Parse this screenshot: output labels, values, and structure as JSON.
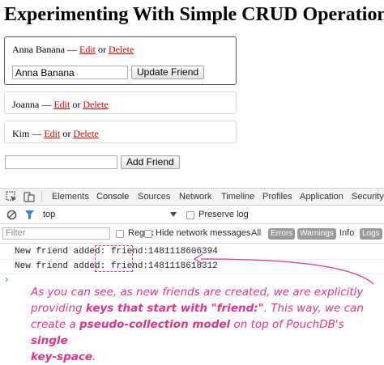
{
  "page": {
    "title": "Experimenting With Simple CRUD Operations Usi",
    "friends": [
      {
        "name": "Anna Banana",
        "dash": "—",
        "edit": "Edit",
        "or": "or",
        "delete": "Delete"
      },
      {
        "name": "Joanna",
        "dash": "—",
        "edit": "Edit",
        "or": "or",
        "delete": "Delete"
      },
      {
        "name": "Kim",
        "dash": "—",
        "edit": "Edit",
        "or": "or",
        "delete": "Delete"
      }
    ],
    "edit_input_value": "Anna Banana",
    "update_button": "Update Friend",
    "add_input_value": "",
    "add_button": "Add Friend"
  },
  "devtools": {
    "tabs": [
      "Elements",
      "Console",
      "Sources",
      "Network",
      "Timeline",
      "Profiles",
      "Application",
      "Security"
    ],
    "active_tab": "Console",
    "context": "top",
    "preserve_log": "Preserve log",
    "filter_placeholder": "Filter",
    "regex": "Regex",
    "hide_network": "Hide network messages",
    "levels": [
      "All",
      "Errors",
      "Warnings",
      "Info",
      "Logs"
    ],
    "console_lines": [
      {
        "prefix": "New friend added: ",
        "key": "friend:1481118606394"
      },
      {
        "prefix": "New friend added: ",
        "key": "friend:1481118618312"
      }
    ],
    "prompt": "›"
  },
  "annotation": {
    "color": "#e0338f",
    "line1": "As you can see, as new friends are created, we are explicitly",
    "line2_a": "providing ",
    "line2_b": "keys that start with \"friend:\"",
    "line2_c": ". This way, we can",
    "line3_a": "create a ",
    "line3_b": "pseudo-collection model",
    "line3_c": " on top of PouchDB's ",
    "line3_d": "single",
    "line4": "key-space",
    "line4_end": "."
  },
  "icons": [
    "inspect-icon",
    "device-icon",
    "clear-icon",
    "filter-icon",
    "dropdown-arrow-icon",
    "prompt-chevron-icon"
  ]
}
